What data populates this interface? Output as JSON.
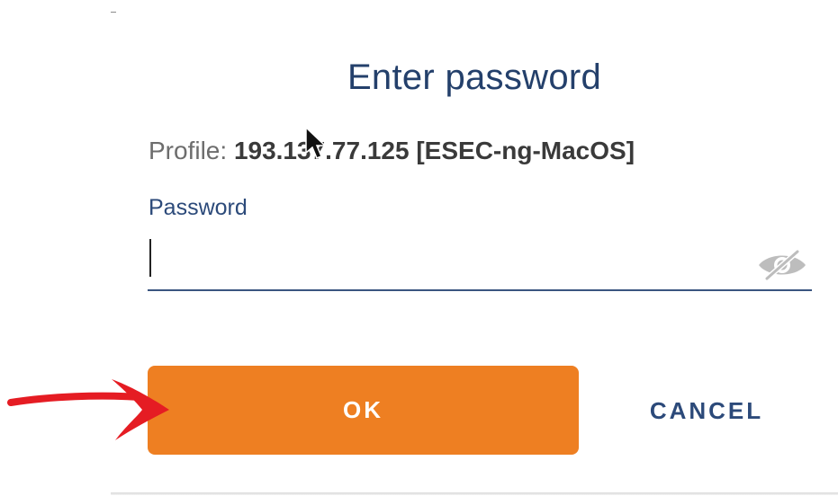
{
  "dialog": {
    "title": "Enter password",
    "profile": {
      "label": "Profile:",
      "value": "193.137.77.125 [ESEC-ng-MacOS]"
    },
    "password": {
      "label": "Password",
      "value": "",
      "placeholder": "",
      "visibility_icon": "eye-off-icon"
    },
    "buttons": {
      "ok_label": "OK",
      "cancel_label": "CANCEL"
    }
  },
  "colors": {
    "title": "#24406b",
    "ok_button": "#ee7f22",
    "cancel_text": "#2c4a7a",
    "annotation_arrow": "#e51c23"
  },
  "annotations": {
    "arrow_icon": "red-arrow-icon"
  }
}
